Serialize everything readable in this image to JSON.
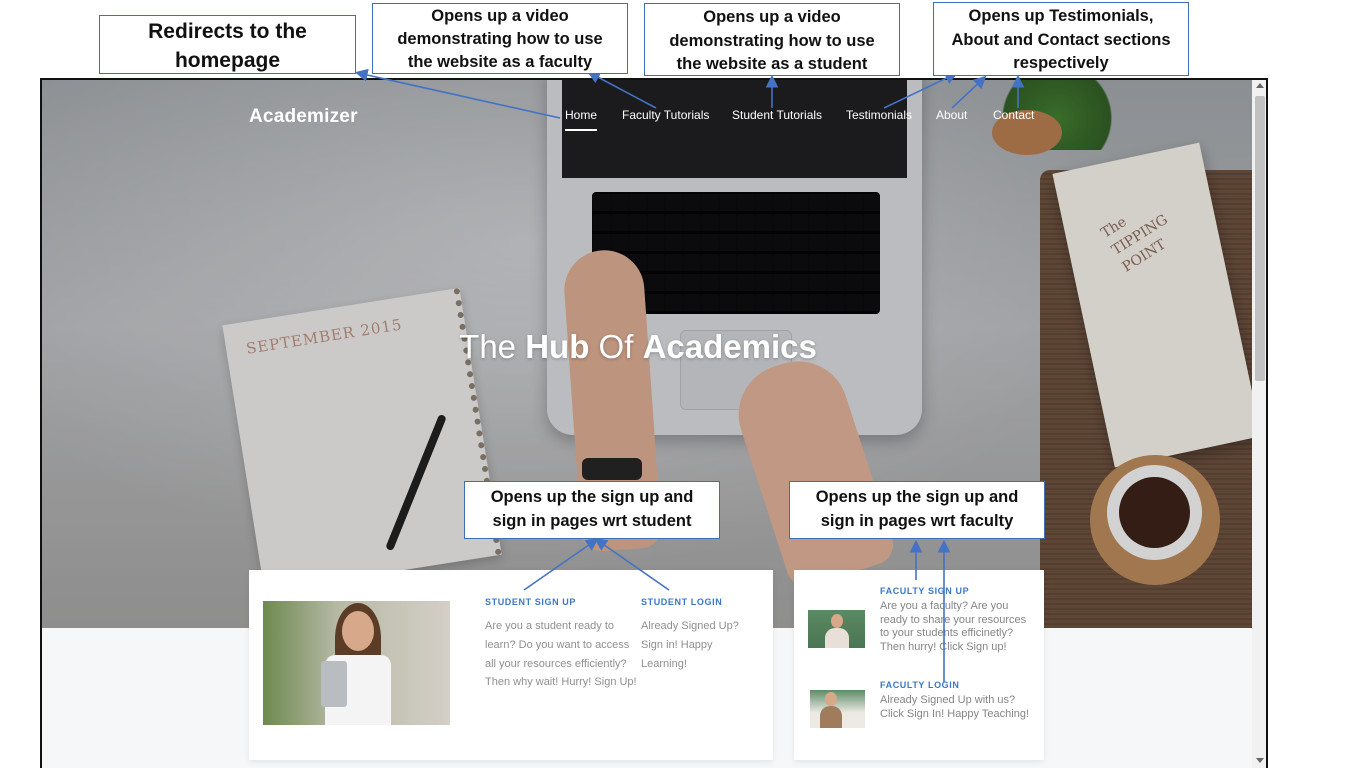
{
  "site": {
    "brand": "Academizer",
    "nav": [
      {
        "label": "Home",
        "active": true
      },
      {
        "label": "Faculty Tutorials",
        "active": false
      },
      {
        "label": "Student Tutorials",
        "active": false
      },
      {
        "label": "Testimonials",
        "active": false
      },
      {
        "label": "About",
        "active": false
      },
      {
        "label": "Contact",
        "active": false
      }
    ],
    "hero": {
      "title_part1": "The ",
      "title_part2": "Hub",
      "title_part3": " Of ",
      "title_part4": "Academics",
      "notebook_text": "SEPTEMBER 2015",
      "book_text_line1": "The",
      "book_text_line2": "TIPPING POINT"
    },
    "student_card": {
      "signup_heading": "STUDENT SIGN UP",
      "signup_text": "Are you a student ready to learn? Do you want to access all your resources efficiently? Then why wait! Hurry! Sign Up!",
      "login_heading": "STUDENT LOGIN",
      "login_text": "Already Signed Up? Sign in! Happy Learning!"
    },
    "faculty_card": {
      "signup_heading": "FACULTY SIGN UP",
      "signup_text": "Are you a faculty? Are you ready to share your resources to your students efficinetly? Then hurry! Click Sign up!",
      "login_heading": "FACULTY LOGIN",
      "login_text": "Already Signed Up with us? Click Sign In! Happy Teaching!"
    }
  },
  "annotations": {
    "home": [
      "Redirects to the",
      "homepage"
    ],
    "faculty_video": [
      "Opens up a video",
      "demonstrating how to use",
      "the website as a faculty"
    ],
    "student_video": [
      "Opens up a video",
      "demonstrating how to use",
      "the website as a student"
    ],
    "sections": [
      "Opens up Testimonials,",
      "About and Contact sections",
      "respectively"
    ],
    "student_signup": [
      "Opens up the sign up and",
      "sign in pages wrt student"
    ],
    "faculty_signup": [
      "Opens up the sign up and",
      "sign in pages wrt faculty"
    ]
  },
  "colors": {
    "annotation_border": "#3f6fb5",
    "arrow": "#4472c4",
    "card_heading": "#3a78c8",
    "card_text": "#8f8f8f"
  },
  "icons": [
    "scroll-up-arrow-icon",
    "scroll-down-arrow-icon"
  ]
}
